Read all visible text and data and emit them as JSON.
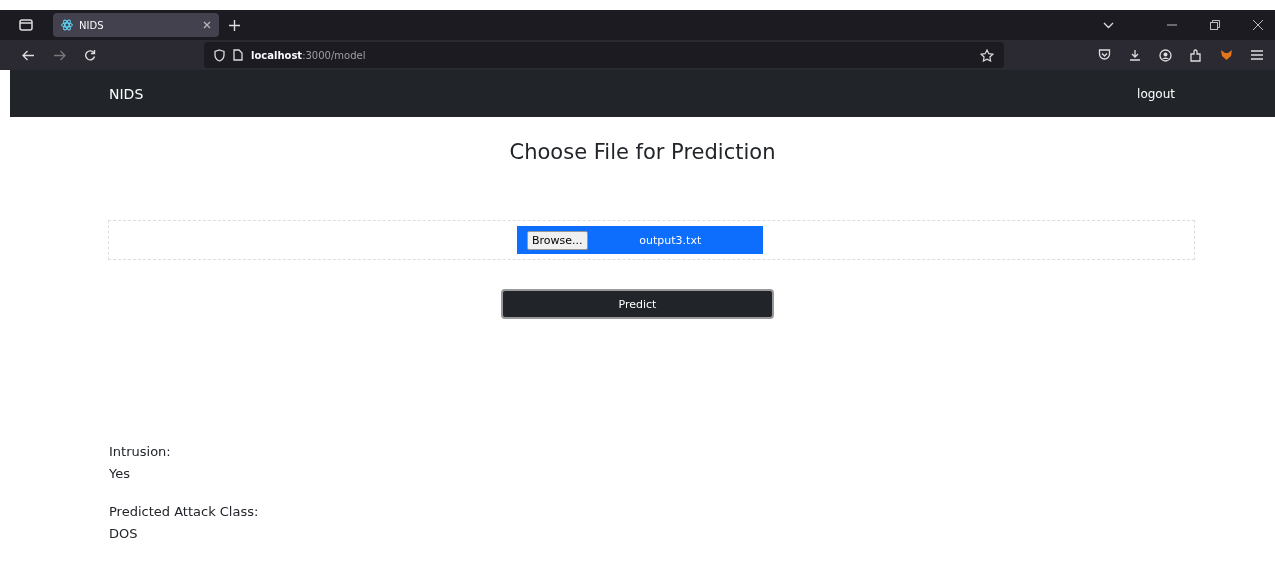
{
  "browser": {
    "tab_title": "NIDS",
    "url": "**localhost**:3000/model"
  },
  "navbar": {
    "brand": "NIDS",
    "logout": "logout"
  },
  "heading": "Choose File for Prediction",
  "file_input": {
    "button": "Browse...",
    "file_name": "output3.txt"
  },
  "predict_button": "Predict",
  "results": [
    {
      "label": "Intrusion:",
      "value": "Yes"
    },
    {
      "label": "Predicted Attack Class:",
      "value": "DOS"
    }
  ]
}
